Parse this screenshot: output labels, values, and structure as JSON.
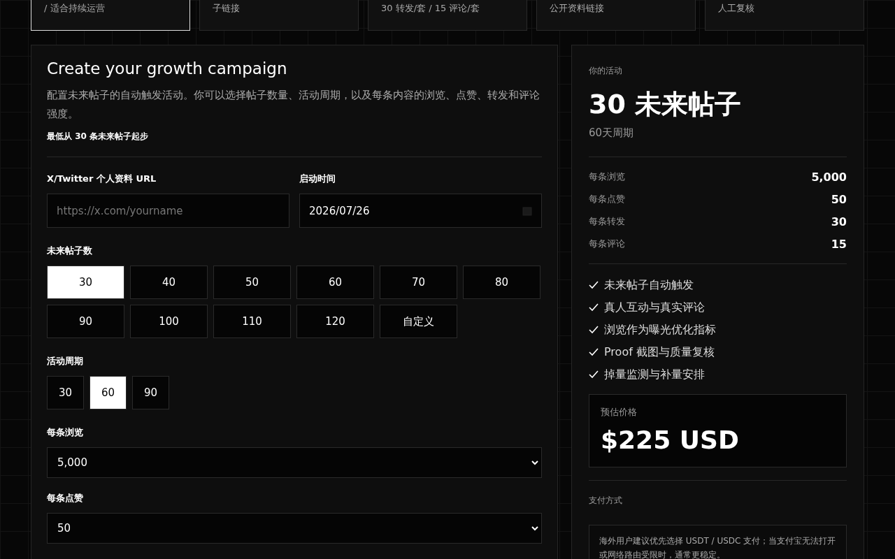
{
  "plans": [
    {
      "text": "/ 适合持续运营",
      "selected": true
    },
    {
      "text": "子链接",
      "selected": false
    },
    {
      "text": "30 转发/套 / 15 评论/套",
      "selected": false
    },
    {
      "text": "公开资料链接",
      "selected": false
    },
    {
      "text": "人工复核",
      "selected": false
    }
  ],
  "form": {
    "title": "Create your growth campaign",
    "description": "配置未来帖子的自动触发活动。你可以选择帖子数量、活动周期，以及每条内容的浏览、点赞、转发和评论强度。",
    "minimum_note": "最低从 30 条未来帖子起步",
    "profile_url": {
      "label": "X/Twitter 个人资料 URL",
      "placeholder": "https://x.com/yourname"
    },
    "start_time": {
      "label": "启动时间",
      "value": "2026/07/26"
    },
    "post_count": {
      "label": "未来帖子数",
      "options": [
        {
          "label": "30",
          "selected": true
        },
        {
          "label": "40",
          "selected": false
        },
        {
          "label": "50",
          "selected": false
        },
        {
          "label": "60",
          "selected": false
        },
        {
          "label": "70",
          "selected": false
        },
        {
          "label": "80",
          "selected": false
        },
        {
          "label": "90",
          "selected": false
        },
        {
          "label": "100",
          "selected": false
        },
        {
          "label": "110",
          "selected": false
        },
        {
          "label": "120",
          "selected": false
        },
        {
          "label": "自定义",
          "selected": false
        }
      ]
    },
    "duration": {
      "label": "活动周期",
      "options": [
        {
          "label": "30",
          "selected": false
        },
        {
          "label": "60",
          "selected": true
        },
        {
          "label": "90",
          "selected": false
        }
      ]
    },
    "selects": [
      {
        "label": "每条浏览",
        "value": "5,000"
      },
      {
        "label": "每条点赞",
        "value": "50"
      }
    ]
  },
  "summary": {
    "eyebrow": "你的活动",
    "headline": "30 未来帖子",
    "period": "60天周期",
    "metrics": [
      {
        "label": "每条浏览",
        "value": "5,000"
      },
      {
        "label": "每条点赞",
        "value": "50"
      },
      {
        "label": "每条转发",
        "value": "30"
      },
      {
        "label": "每条评论",
        "value": "15"
      }
    ],
    "features": [
      "未来帖子自动触发",
      "真人互动与真实评论",
      "浏览作为曝光优化指标",
      "Proof 截图与质量复核",
      "掉量监测与补量安排"
    ],
    "price": {
      "label": "预估价格",
      "value": "$225 USD"
    },
    "payment": {
      "label": "支付方式",
      "note": "海外用户建议优先选择 USDT / USDC 支付；当支付宝无法打开或网络路由受限时，通常更稳定。"
    }
  }
}
